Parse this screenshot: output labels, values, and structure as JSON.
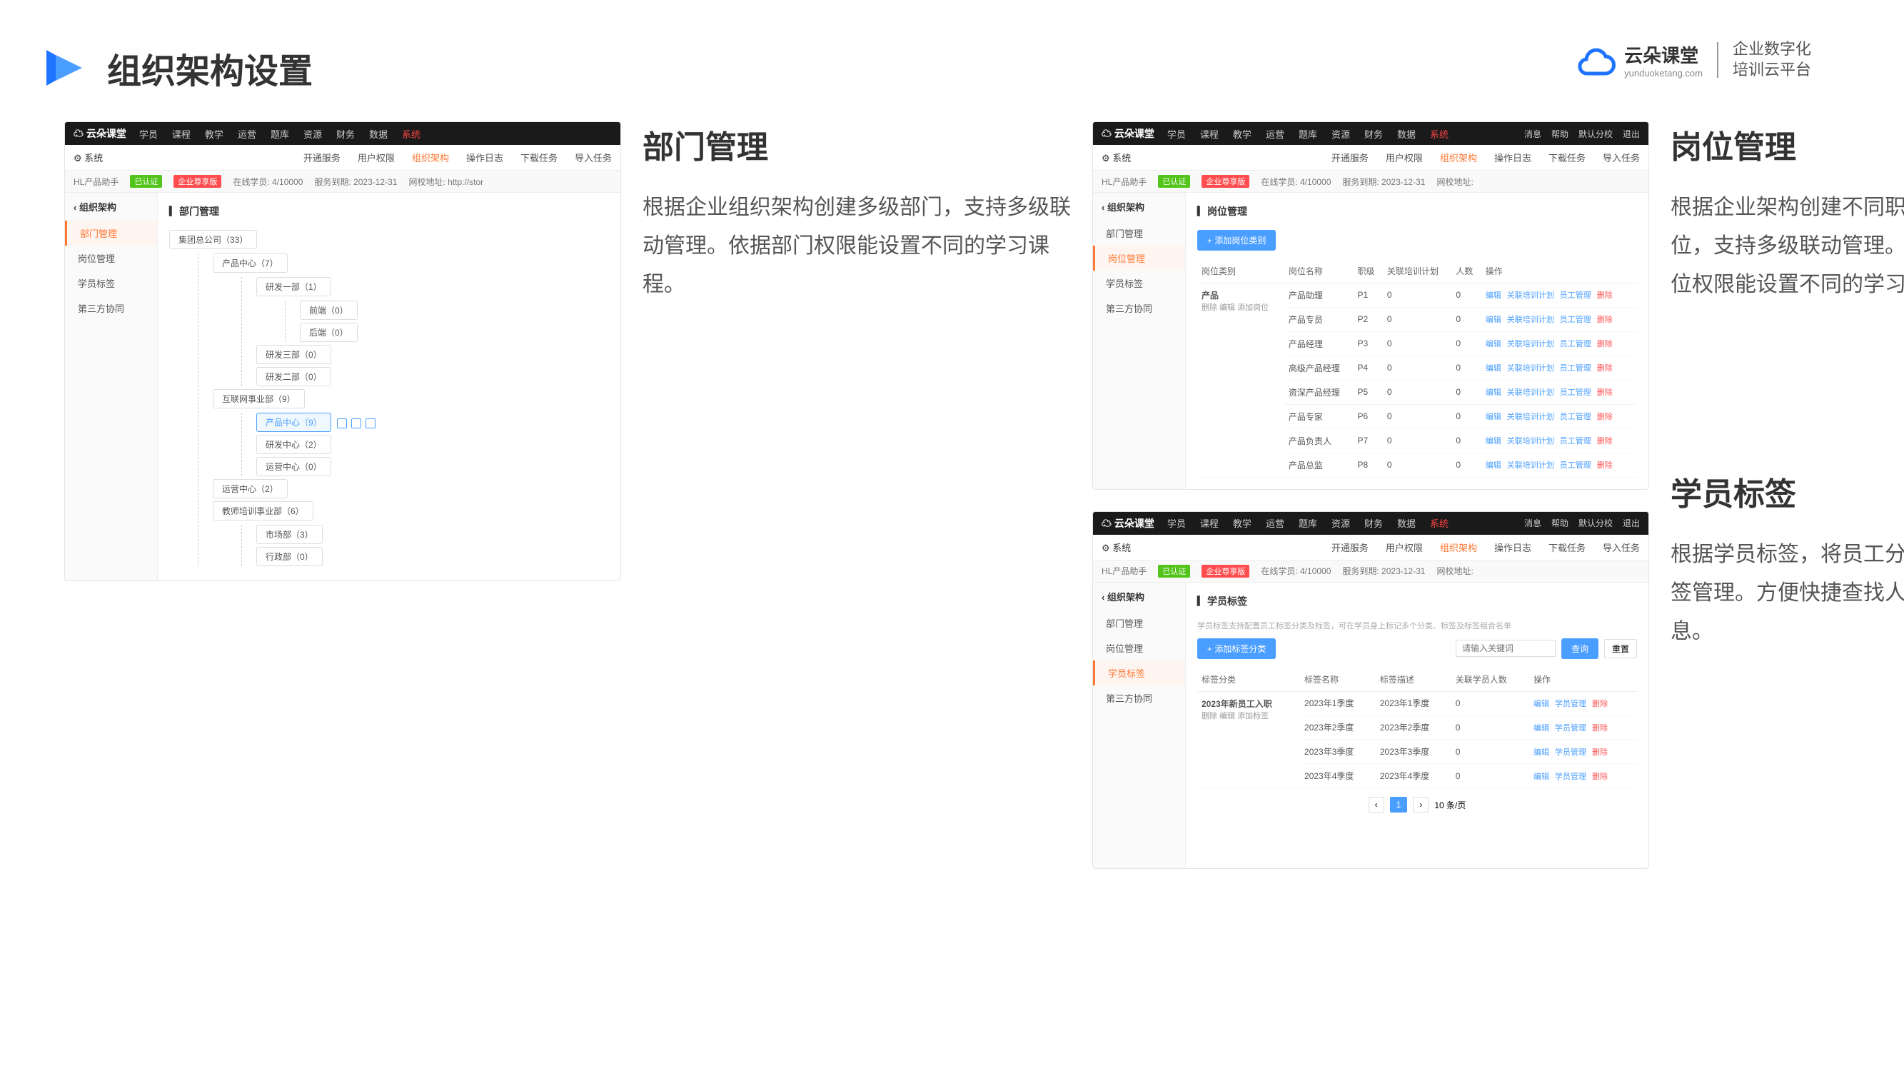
{
  "header": {
    "title": "组织架构设置"
  },
  "logo": {
    "brand": "云朵课堂",
    "url": "yunduoketang.com",
    "tagline1": "企业数字化",
    "tagline2": "培训云平台"
  },
  "sections": {
    "dept": {
      "title": "部门管理",
      "desc": "根据企业组织架构创建多级部门，支持多级联动管理。依据部门权限能设置不同的学习课程。"
    },
    "post": {
      "title": "岗位管理",
      "desc": "根据企业架构创建不同职级岗位，支持多级联动管理。依据岗位权限能设置不同的学习权限。"
    },
    "tag": {
      "title": "学员标签",
      "desc": "根据学员标签，将员工分多类标签管理。方便快捷查找人员信息。"
    }
  },
  "topnav": [
    "学员",
    "课程",
    "教学",
    "运营",
    "题库",
    "资源",
    "财务",
    "数据",
    "系统"
  ],
  "subnav": {
    "system": "系统",
    "items": [
      "开通服务",
      "用户权限",
      "组织架构",
      "操作日志",
      "下载任务",
      "导入任务"
    ]
  },
  "crumb": {
    "company": "HL产品助手",
    "verified": "已认证",
    "plan": "企业尊享版",
    "online": "在线学员: 4/10000",
    "expire": "服务到期: 2023-12-31",
    "url": "网校地址: http://stor"
  },
  "sidebar": {
    "header": "组织架构",
    "items": [
      "部门管理",
      "岗位管理",
      "学员标签",
      "第三方协同"
    ]
  },
  "dept_tree": {
    "root": "集团总公司（33）",
    "l1a": "产品中心（7）",
    "l2a": "研发一部（1）",
    "l3a": "前端（0）",
    "l3b": "后端（0）",
    "l2b": "研发三部（0）",
    "l2c": "研发二部（0）",
    "l1b": "互联网事业部（9）",
    "l2d": "产品中心（9）",
    "l2e": "研发中心（2）",
    "l2f": "运营中心（0）",
    "l1c": "运营中心（2）",
    "l1d": "教师培训事业部（6）",
    "l2g": "市场部（3）",
    "l2h": "行政部（0）",
    "main_title": "部门管理"
  },
  "post_screen": {
    "main_title": "岗位管理",
    "add_btn": "+ 添加岗位类别",
    "headers": [
      "岗位类别",
      "岗位名称",
      "职级",
      "关联培训计划",
      "人数",
      "操作"
    ],
    "category": "产品",
    "sub": "删除  编辑  添加岗位",
    "rows": [
      {
        "name": "产品助理",
        "level": "P1",
        "plan": "0",
        "count": "0"
      },
      {
        "name": "产品专员",
        "level": "P2",
        "plan": "0",
        "count": "0"
      },
      {
        "name": "产品经理",
        "level": "P3",
        "plan": "0",
        "count": "0"
      },
      {
        "name": "高级产品经理",
        "level": "P4",
        "plan": "0",
        "count": "0"
      },
      {
        "name": "资深产品经理",
        "level": "P5",
        "plan": "0",
        "count": "0"
      },
      {
        "name": "产品专家",
        "level": "P6",
        "plan": "0",
        "count": "0"
      },
      {
        "name": "产品负责人",
        "level": "P7",
        "plan": "0",
        "count": "0"
      },
      {
        "name": "产品总监",
        "level": "P8",
        "plan": "0",
        "count": "0"
      }
    ],
    "actions": {
      "edit": "编辑",
      "plan": "关联培训计划",
      "emp": "员工管理",
      "del": "删除"
    }
  },
  "tag_screen": {
    "main_title": "学员标签",
    "help": "学员标签支持配置员工标签分类及标签，可在学员身上标记多个分类、标签及标签组合名单",
    "add_btn": "+ 添加标签分类",
    "search_placeholder": "请输入关键词",
    "search_btn": "查询",
    "reset_btn": "重置",
    "headers": [
      "标签分类",
      "标签名称",
      "标签描述",
      "关联学员人数",
      "操作"
    ],
    "category": "2023年新员工入职",
    "sub": "删除  编辑  添加标签",
    "rows": [
      {
        "name": "2023年1季度",
        "desc": "2023年1季度",
        "count": "0"
      },
      {
        "name": "2023年2季度",
        "desc": "2023年2季度",
        "count": "0"
      },
      {
        "name": "2023年3季度",
        "desc": "2023年3季度",
        "count": "0"
      },
      {
        "name": "2023年4季度",
        "desc": "2023年4季度",
        "count": "0"
      }
    ],
    "actions": {
      "edit": "编辑",
      "emp": "学员管理",
      "del": "删除"
    },
    "pagination": {
      "page": "1",
      "per": "10 条/页"
    }
  },
  "right_tools": {
    "msg": "消息",
    "help": "帮助",
    "branch": "默认分校",
    "exit": "退出"
  }
}
